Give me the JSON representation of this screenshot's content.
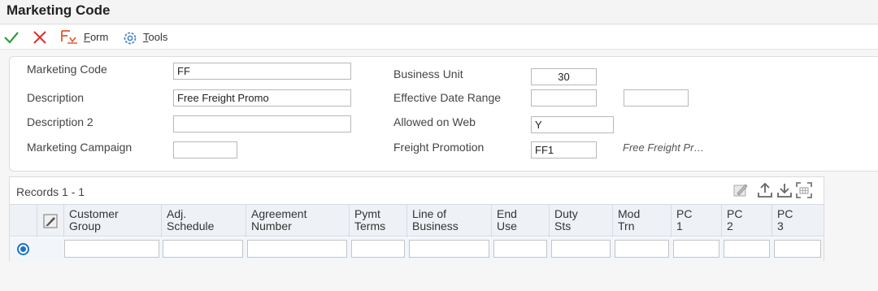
{
  "window": {
    "title": "Marketing Code"
  },
  "toolbar": {
    "ok_icon": "checkmark-icon",
    "cancel_icon": "close-icon",
    "form_prefix": "F",
    "form_rest": "orm",
    "tools_prefix": "T",
    "tools_rest": "ools"
  },
  "header": {
    "marketing_code": {
      "label": "Marketing Code",
      "value": "FF"
    },
    "description": {
      "label": "Description",
      "value": "Free Freight Promo"
    },
    "description2": {
      "label": "Description 2",
      "value": ""
    },
    "marketing_campaign": {
      "label": "Marketing Campaign",
      "value": ""
    },
    "business_unit": {
      "label": "Business Unit",
      "value": "30"
    },
    "effective_date_range": {
      "label": "Effective Date Range",
      "from": "",
      "to": ""
    },
    "allowed_on_web": {
      "label": "Allowed on Web",
      "value": "Y"
    },
    "freight_promotion": {
      "label": "Freight Promotion",
      "value": "FF1",
      "description": "Free Freight Pr…"
    }
  },
  "grid": {
    "records_label": "Records 1 - 1",
    "columns": [
      {
        "line1": "Customer",
        "line2": "Group"
      },
      {
        "line1": "Adj.",
        "line2": "Schedule"
      },
      {
        "line1": "Agreement",
        "line2": "Number"
      },
      {
        "line1": "Pymt",
        "line2": "Terms"
      },
      {
        "line1": "Line of",
        "line2": "Business"
      },
      {
        "line1": "End",
        "line2": "Use"
      },
      {
        "line1": "Duty",
        "line2": "Sts"
      },
      {
        "line1": "Mod",
        "line2": "Trn"
      },
      {
        "line1": "PC",
        "line2": "1"
      },
      {
        "line1": "PC",
        "line2": "2"
      },
      {
        "line1": "PC",
        "line2": "3"
      }
    ],
    "rows": [
      {
        "selected": true,
        "cells": [
          "",
          "",
          "",
          "",
          "",
          "",
          "",
          "",
          "",
          "",
          ""
        ]
      }
    ]
  },
  "colors": {
    "accent": "#1a73c7",
    "ok_green": "#2e9e3c",
    "cancel_red": "#d9322b",
    "form_orange": "#e2532d"
  }
}
